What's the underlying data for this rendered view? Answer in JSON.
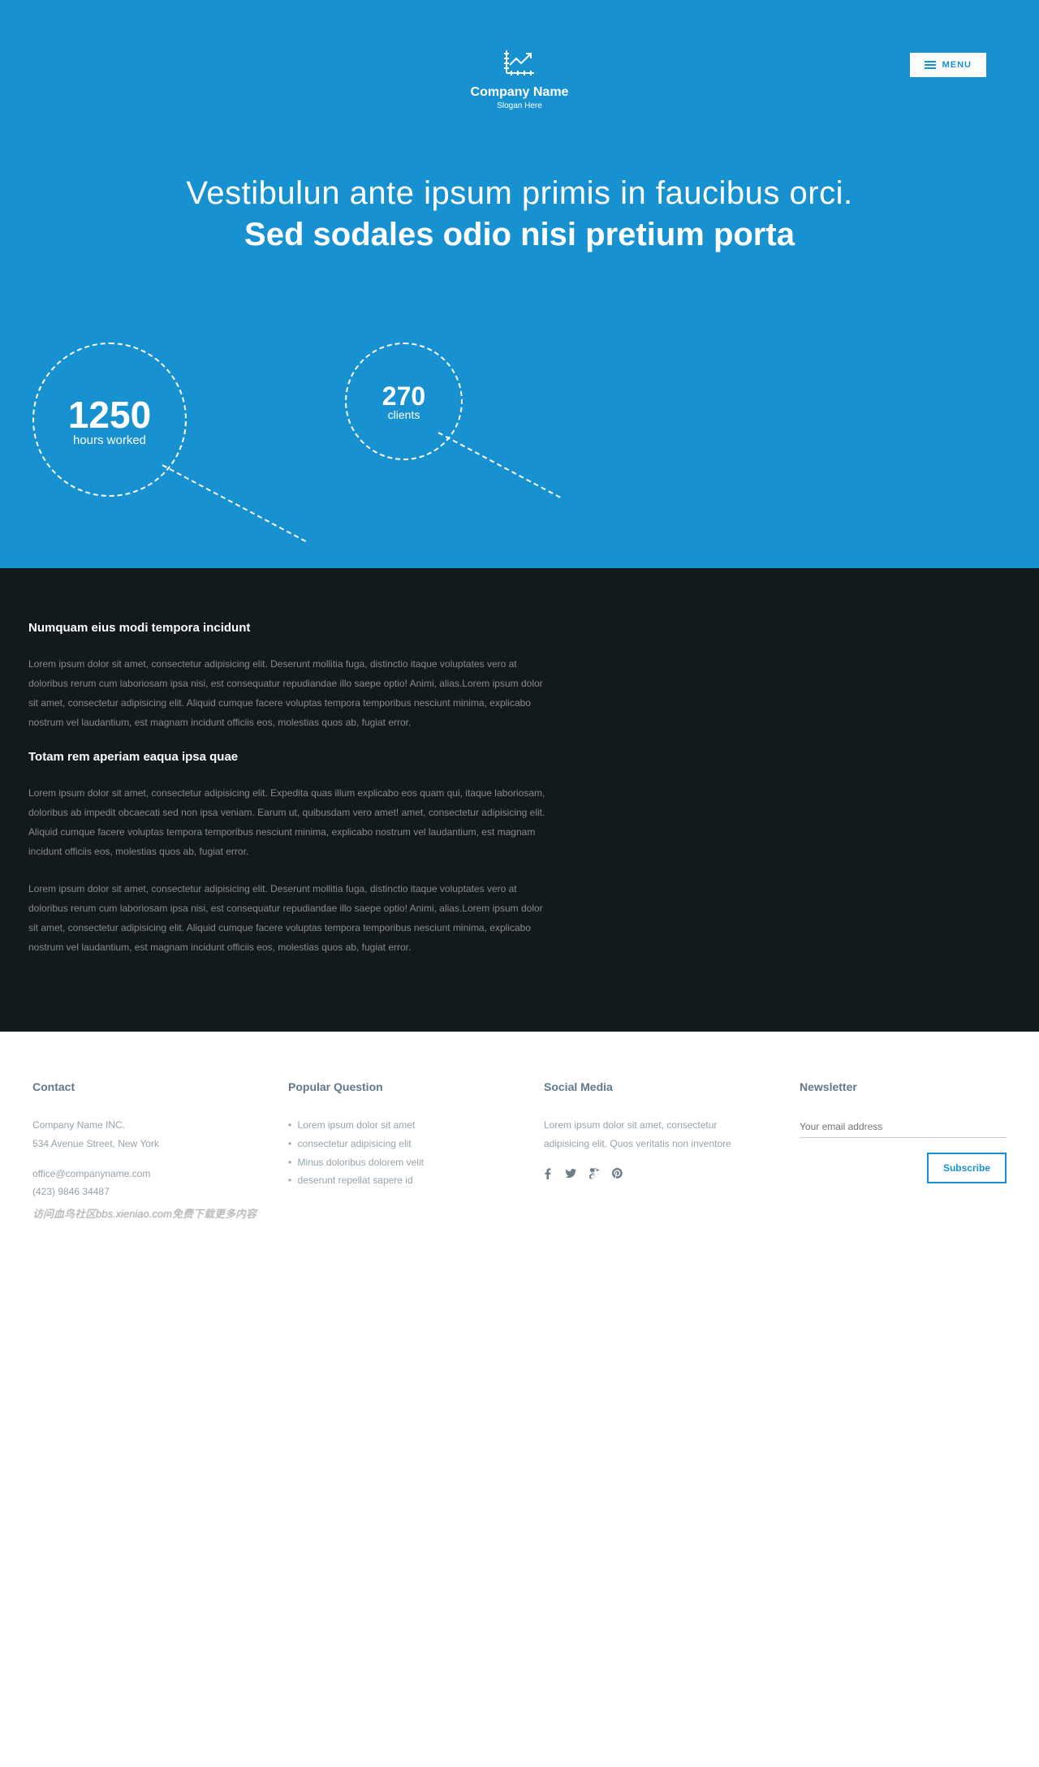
{
  "menu": {
    "label": "MENU"
  },
  "logo": {
    "company": "Company Name",
    "slogan": "Slogan Here"
  },
  "hero": {
    "line1": "Vestibulun ante ipsum primis in faucibus orci.",
    "line2": "Sed sodales odio nisi pretium porta"
  },
  "stats": [
    {
      "value": "1250",
      "label": "hours worked"
    },
    {
      "value": "270",
      "label": "clients"
    }
  ],
  "dark": {
    "h1": "Numquam eius modi tempora incidunt",
    "p1": "Lorem ipsum dolor sit amet, consectetur adipisicing elit. Deserunt mollitia fuga, distinctio itaque voluptates vero at doloribus rerum cum laboriosam ipsa nisi, est consequatur repudiandae illo saepe optio! Animi, alias.Lorem ipsum dolor sit amet, consectetur adipisicing elit. Aliquid cumque facere voluptas tempora temporibus nesciunt minima, explicabo nostrum vel laudantium, est magnam incidunt officiis eos, molestias quos ab, fugiat error.",
    "h2": "Totam rem aperiam eaqua ipsa quae",
    "p2": "Lorem ipsum dolor sit amet, consectetur adipisicing elit. Expedita quas illum explicabo eos quam qui, itaque laboriosam, doloribus ab impedit obcaecati sed non ipsa veniam. Earum ut, quibusdam vero amet! amet, consectetur adipisicing elit. Aliquid cumque facere voluptas tempora temporibus nesciunt minima, explicabo nostrum vel laudantium, est magnam incidunt officiis eos, molestias quos ab, fugiat error.",
    "p3": "Lorem ipsum dolor sit amet, consectetur adipisicing elit. Deserunt mollitia fuga, distinctio itaque voluptates vero at doloribus rerum cum laboriosam ipsa nisi, est consequatur repudiandae illo saepe optio! Animi, alias.Lorem ipsum dolor sit amet, consectetur adipisicing elit. Aliquid cumque facere voluptas tempora temporibus nesciunt minima, explicabo nostrum vel laudantium, est magnam incidunt officiis eos, molestias quos ab, fugiat error."
  },
  "footer": {
    "contact": {
      "title": "Contact",
      "name": "Company Name INC.",
      "addr": "534 Avenue Street, New York",
      "email": "office@companyname.com",
      "phone": "(423) 9846 34487"
    },
    "popular": {
      "title": "Popular Question",
      "items": [
        "Lorem ipsum dolor sit amet",
        "consectetur adipisicing elit",
        "Minus doloribus dolorem velit",
        "deserunt repellat sapere id"
      ]
    },
    "social": {
      "title": "Social Media",
      "text": "Lorem ipsum dolor sit amet, consectetur adipisicing elit. Quos veritatis non inventore"
    },
    "newsletter": {
      "title": "Newsletter",
      "placeholder": "Your email address",
      "button": "Subscribe"
    }
  },
  "watermark": "访问血鸟社区bbs.xieniao.com免费下载更多内容"
}
